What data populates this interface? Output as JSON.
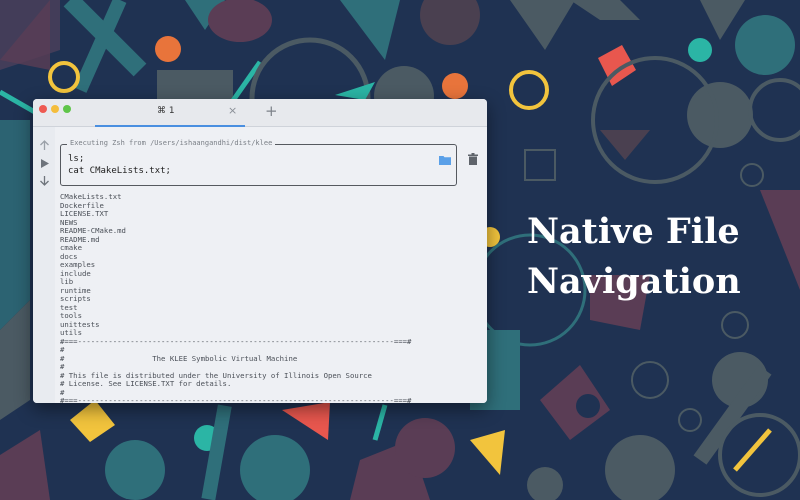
{
  "colors": {
    "background": "#1f3252",
    "tab_accent": "#4a8fe0",
    "folder": "#5aa0e8"
  },
  "window": {
    "tab": {
      "label": "⌘ 1",
      "close": "×"
    },
    "new_tab": "+",
    "gutter_icons": [
      "up-arrow-icon",
      "play-icon",
      "down-arrow-icon"
    ],
    "command": {
      "legend": "Executing Zsh from /Users/ishaangandhi/dist/klee",
      "lines": [
        "ls;",
        "cat CMakeLists.txt;"
      ]
    },
    "output": "CMakeLists.txt\nDockerfile\nLICENSE.TXT\nNEWS\nREADME-CMake.md\nREADME.md\ncmake\ndocs\nexamples\ninclude\nlib\nruntime\nscripts\ntest\ntools\nunittests\nutils\n#===------------------------------------------------------------------------===#\n#\n#                    The KLEE Symbolic Virtual Machine\n#\n# This file is distributed under the University of Illinois Open Source\n# License. See LICENSE.TXT for details.\n#\n#===------------------------------------------------------------------------===#"
  },
  "hero": {
    "line1": "Native File",
    "line2": "Navigation"
  }
}
